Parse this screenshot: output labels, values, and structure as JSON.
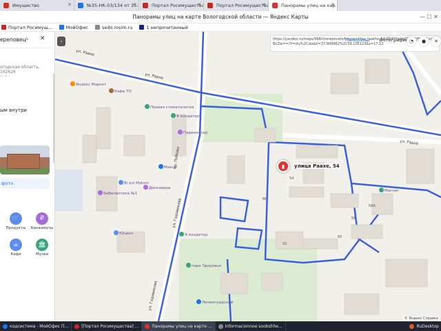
{
  "colors": {
    "accent": "#1e73e8",
    "pin": "#e22f2f",
    "route": "#3a5fe0",
    "road": "#ffffff",
    "taskbar": "#1f2430"
  },
  "tabs": [
    {
      "label": "Имущество",
      "favicon": "#d93025",
      "active": false
    },
    {
      "label": "№35-НК-03/134 от 15.01...",
      "favicon": "#1e73e8",
      "active": false
    },
    {
      "label": "Портал Росимущества",
      "favicon": "#c62828",
      "active": false
    },
    {
      "label": "Портал Росимущества",
      "favicon": "#c62828",
      "active": false
    },
    {
      "label": "Панорамы улиц на кар...",
      "favicon": "#e22f2f",
      "active": true
    }
  ],
  "window": {
    "title": "Панорамы улиц на карте Вологодской области — Яндекс Карты",
    "controls": "— ☐ ✕"
  },
  "bookmarks": [
    {
      "label": "Портал Росимущ...",
      "icon": "#c62828"
    },
    {
      "label": "МойОфис",
      "icon": "#1e73e8"
    },
    {
      "label": "sedo.rosim.ru",
      "icon": "#888888"
    },
    {
      "label": "1 непрочитанный",
      "icon": "#1a237e"
    }
  ],
  "sidebar": {
    "city": "ереповец",
    "search_icon": "⌕",
    "close_icon": "✕",
    "address": "огодская область, 162626",
    "more": "···",
    "inside_label": "ым внутри",
    "photo_label": "фото",
    "categories": [
      {
        "label": "Продукты",
        "icon": "cart-icon",
        "glyph": "🛒",
        "color": "#5b8def"
      },
      {
        "label": "Банкоматы",
        "icon": "ruble-icon",
        "glyph": "₽",
        "color": "#a66bd6"
      },
      {
        "label": "Кафе",
        "icon": "cafe-icon",
        "glyph": "☕",
        "color": "#5b8def"
      },
      {
        "label": "Музеи",
        "icon": "museum-icon",
        "glyph": "🏛",
        "color": "#3aa37a"
      }
    ]
  },
  "map": {
    "url_text": "https://yandex.ru/maps/968/cherepovets/house/ulitsa_raakhe_54/Z04YYwVoQEwGQFtyfX1xcHBnZw==/?l=stv%2Csta&ll=37.909962%2C59.105123&z=17.12",
    "layers": {
      "panoramas": "Панорамы",
      "photos": "Фотографии"
    },
    "collapse": "‹",
    "selected_address": "улица Раахе, 54",
    "streets": [
      {
        "text": "ул. Раахе",
        "pos": "s1"
      },
      {
        "text": "ул. Раахе",
        "pos": "s2"
      },
      {
        "text": "ул. Раахе",
        "pos": "s3"
      },
      {
        "text": "ул. Годовикова",
        "pos": "s4"
      },
      {
        "text": "пр. Победы",
        "pos": "s5"
      },
      {
        "text": "ул. Годовикова",
        "pos": "s6"
      }
    ],
    "pois": [
      {
        "text": "Яндекс Маркет",
        "color": "#ff8c00"
      },
      {
        "text": "Кафе ТО",
        "color": "#a36a3b"
      },
      {
        "text": "Я кондитер",
        "color": "#3aa37a"
      },
      {
        "text": "Первая стоматология",
        "color": "#3aa37a"
      },
      {
        "text": "Парикмахер",
        "color": "#a66bd6"
      },
      {
        "text": "Макси",
        "color": "#1e73e8"
      },
      {
        "text": "Bi ovi Motors",
        "color": "#5b8def"
      },
      {
        "text": "Бибилиотека №1",
        "color": "#a66bd6"
      },
      {
        "text": "Дискавери",
        "color": "#a66bd6"
      },
      {
        "text": "Юнион",
        "color": "#5b8def"
      },
      {
        "text": "Я кондитер",
        "color": "#3aa37a"
      },
      {
        "text": "парк Здоровья",
        "color": "#3aa37a"
      },
      {
        "text": "Ленинградский",
        "color": "#1e73e8"
      },
      {
        "text": "Магнит",
        "color": "#3aa37a"
      }
    ],
    "house_numbers": [
      "56",
      "58А",
      "52",
      "60",
      "54",
      "36"
    ],
    "copyright": "© Яндекс  Справка"
  },
  "taskbar": {
    "items": [
      {
        "label": "кодсистема - МойОфис П...",
        "color": "#1e73e8",
        "active": false
      },
      {
        "label": "[Портал Росимущества] ...",
        "color": "#c62828",
        "active": false
      },
      {
        "label": "Панорамы улиц на карте ...",
        "color": "#e22f2f",
        "active": true
      },
      {
        "label": "Informacionnoe soobshhe...",
        "color": "#888888",
        "active": false
      }
    ],
    "tray_app": "RuDesktop",
    "tray_time": ""
  }
}
